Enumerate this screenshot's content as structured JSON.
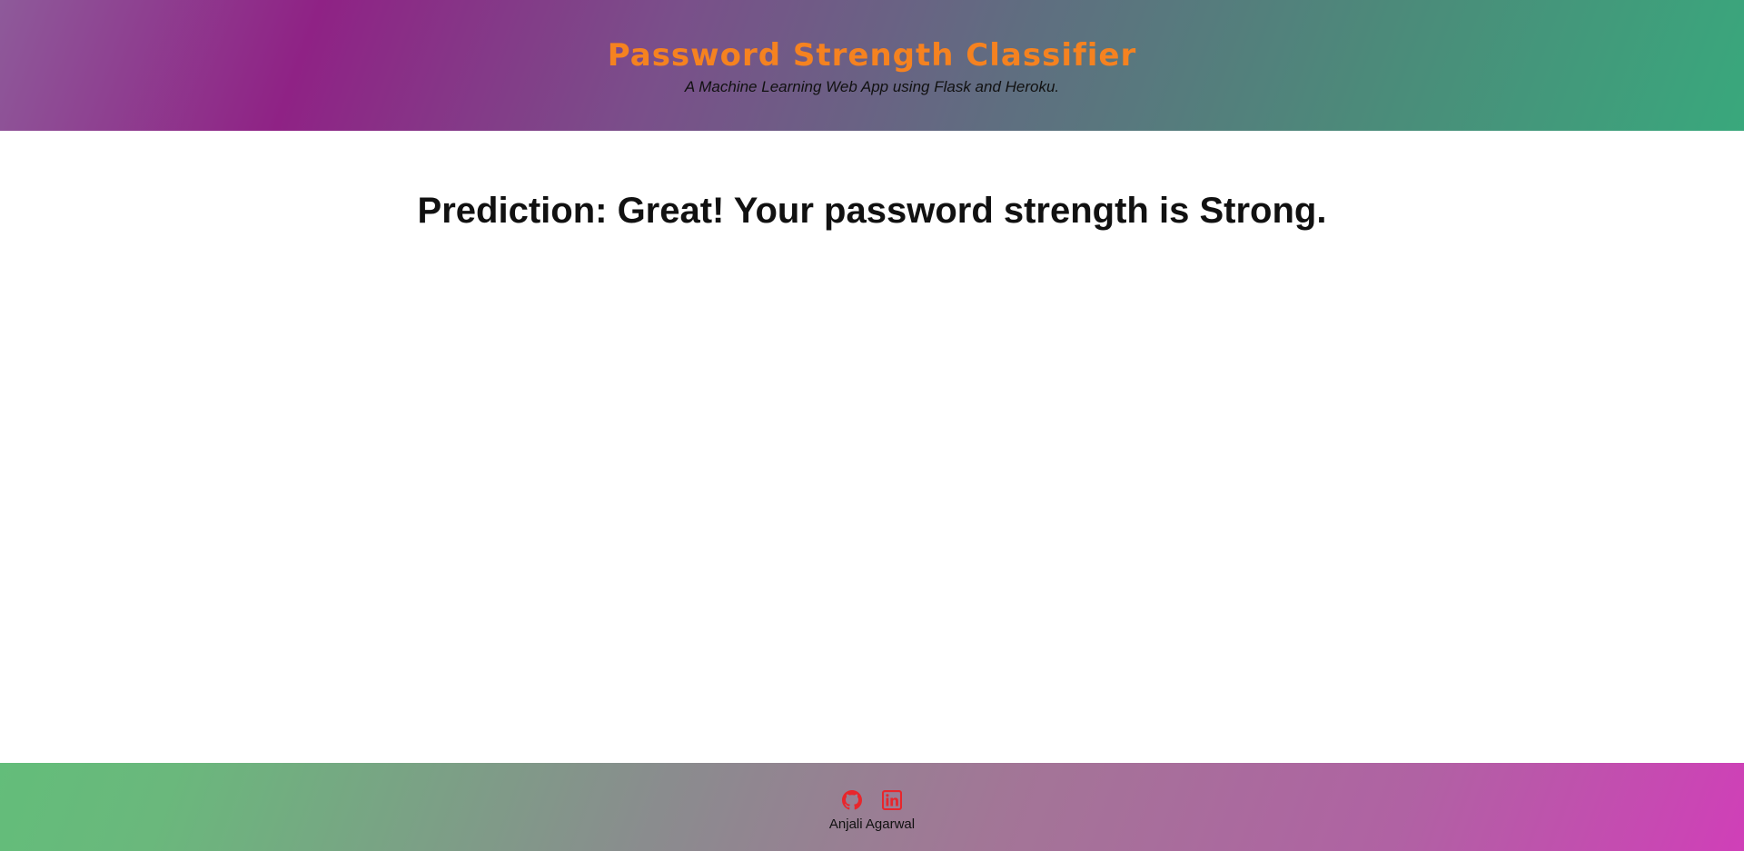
{
  "header": {
    "title": "Password Strength Classifier",
    "subtitle": "A Machine Learning Web App using Flask and Heroku."
  },
  "main": {
    "prediction_text": "Prediction: Great! Your password strength is Strong."
  },
  "footer": {
    "social_icons": [
      "github-icon",
      "linkedin-icon"
    ],
    "author": "Anjali Agarwal"
  },
  "colors": {
    "title": "#f58220",
    "icon": "#e8262c",
    "text": "#111111"
  }
}
